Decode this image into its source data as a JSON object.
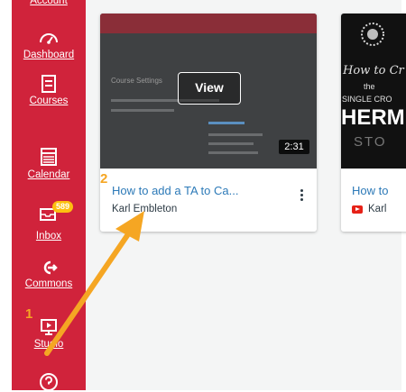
{
  "sidebar": {
    "items": [
      {
        "label": "Account",
        "icon": "account-icon"
      },
      {
        "label": "Dashboard",
        "icon": "dashboard-icon"
      },
      {
        "label": "Courses",
        "icon": "courses-icon"
      },
      {
        "label": "Calendar",
        "icon": "calendar-icon"
      },
      {
        "label": "Inbox",
        "icon": "inbox-icon",
        "badge": "589"
      },
      {
        "label": "Commons",
        "icon": "commons-icon"
      },
      {
        "label": "Studio",
        "icon": "studio-icon"
      },
      {
        "label": "",
        "icon": "help-icon"
      }
    ]
  },
  "annotations": {
    "step1": "1",
    "step2": "2",
    "arrow_color": "#f5a623"
  },
  "videos": [
    {
      "title": "How to add a TA to Ca...",
      "author": "Karl Embleton",
      "view_label": "View",
      "duration": "2:31",
      "thumbnail_text": "Course Settings"
    },
    {
      "title": "How to",
      "author": "Karl",
      "thumbnail_lines": [
        "How to Cr",
        "the",
        "SINGLE CRO",
        "HERM",
        "STO"
      ]
    }
  ],
  "colors": {
    "rail": "#d0233b",
    "link": "#2d7ab8",
    "badge": "#fdc010"
  }
}
